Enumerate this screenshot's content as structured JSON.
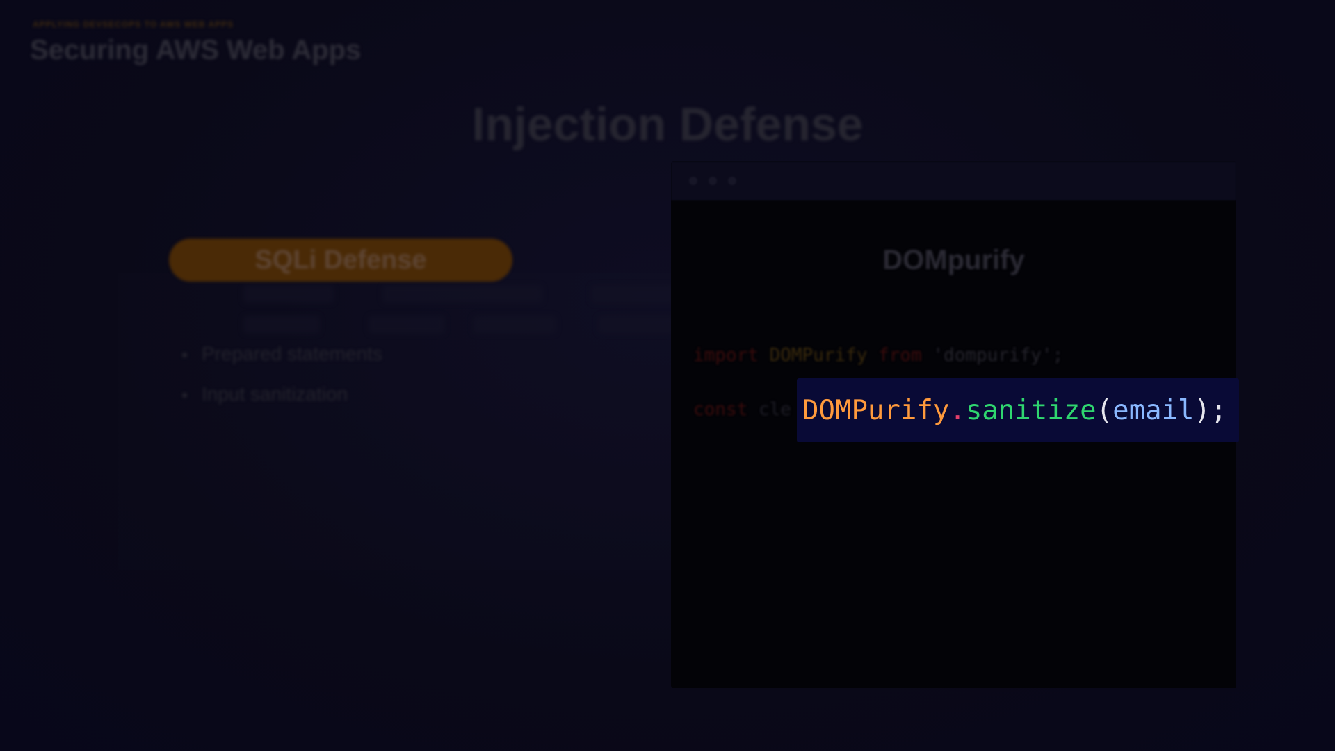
{
  "header": {
    "eyebrow": "APPLYING DEVSECOPS TO AWS WEB APPS",
    "course_title": "Securing AWS Web Apps"
  },
  "slide": {
    "title": "Injection Defense"
  },
  "left_panel": {
    "pill_label": "SQLi Defense",
    "bullets": [
      "Prepared statements",
      "Input sanitization"
    ]
  },
  "code_window": {
    "title": "DOMpurify",
    "line1": {
      "keyword": "import",
      "identifier": "DOMPurify",
      "from": "from",
      "module": "'dompurify';"
    },
    "line2": {
      "keyword": "const",
      "prefix": "cle"
    },
    "highlight": {
      "object": "DOMPurify",
      "dot": ".",
      "method": "sanitize",
      "open": "(",
      "argument": "email",
      "close": ");"
    }
  },
  "colors": {
    "accent_orange": "#ff9a3c",
    "method_green": "#2fd66f",
    "argument_blue": "#8ab8ff",
    "dot_pink": "#e23f6b",
    "highlight_bg": "#090a36"
  }
}
